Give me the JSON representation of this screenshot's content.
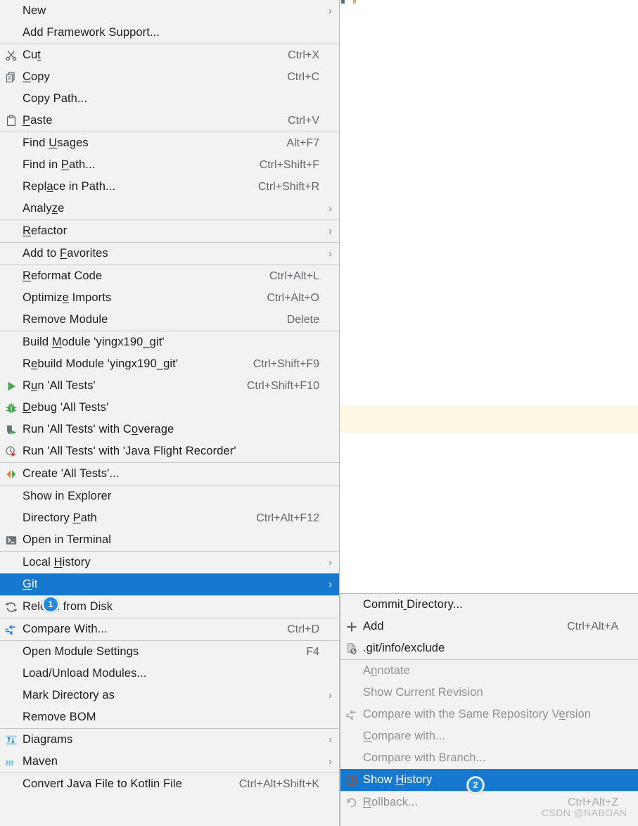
{
  "watermark": "CSDN @NABOAN",
  "context_menu": {
    "groups": [
      {
        "items": [
          {
            "label": "New",
            "accel": "",
            "icon": "",
            "arrow": true,
            "disabled": false,
            "selected": false,
            "mnemonic": -1
          },
          {
            "label": "Add Framework Support...",
            "accel": "",
            "icon": "",
            "arrow": false,
            "disabled": false,
            "selected": false,
            "mnemonic": -1
          }
        ]
      },
      {
        "items": [
          {
            "label": "Cut",
            "accel": "Ctrl+X",
            "icon": "scissors-icon",
            "arrow": false,
            "disabled": false,
            "selected": false,
            "mnemonic": 2
          },
          {
            "label": "Copy",
            "accel": "Ctrl+C",
            "icon": "copy-icon",
            "arrow": false,
            "disabled": false,
            "selected": false,
            "mnemonic": 0
          },
          {
            "label": "Copy Path...",
            "accel": "",
            "icon": "",
            "arrow": false,
            "disabled": false,
            "selected": false,
            "mnemonic": -1
          },
          {
            "label": "Paste",
            "accel": "Ctrl+V",
            "icon": "clipboard-icon",
            "arrow": false,
            "disabled": false,
            "selected": false,
            "mnemonic": 0
          }
        ]
      },
      {
        "items": [
          {
            "label": "Find Usages",
            "accel": "Alt+F7",
            "icon": "",
            "arrow": false,
            "disabled": false,
            "selected": false,
            "mnemonic": 5
          },
          {
            "label": "Find in Path...",
            "accel": "Ctrl+Shift+F",
            "icon": "",
            "arrow": false,
            "disabled": false,
            "selected": false,
            "mnemonic": 8
          },
          {
            "label": "Replace in Path...",
            "accel": "Ctrl+Shift+R",
            "icon": "",
            "arrow": false,
            "disabled": false,
            "selected": false,
            "mnemonic": 4
          },
          {
            "label": "Analyze",
            "accel": "",
            "icon": "",
            "arrow": true,
            "disabled": false,
            "selected": false,
            "mnemonic": 5
          }
        ]
      },
      {
        "items": [
          {
            "label": "Refactor",
            "accel": "",
            "icon": "",
            "arrow": true,
            "disabled": false,
            "selected": false,
            "mnemonic": 0
          }
        ]
      },
      {
        "items": [
          {
            "label": "Add to Favorites",
            "accel": "",
            "icon": "",
            "arrow": true,
            "disabled": false,
            "selected": false,
            "mnemonic": 7
          }
        ]
      },
      {
        "items": [
          {
            "label": "Reformat Code",
            "accel": "Ctrl+Alt+L",
            "icon": "",
            "arrow": false,
            "disabled": false,
            "selected": false,
            "mnemonic": 0
          },
          {
            "label": "Optimize Imports",
            "accel": "Ctrl+Alt+O",
            "icon": "",
            "arrow": false,
            "disabled": false,
            "selected": false,
            "mnemonic": 7
          },
          {
            "label": "Remove Module",
            "accel": "Delete",
            "icon": "",
            "arrow": false,
            "disabled": false,
            "selected": false,
            "mnemonic": -1
          }
        ]
      },
      {
        "items": [
          {
            "label": "Build Module 'yingx190_git'",
            "accel": "",
            "icon": "",
            "arrow": false,
            "disabled": false,
            "selected": false,
            "mnemonic": 6
          },
          {
            "label": "Rebuild Module 'yingx190_git'",
            "accel": "Ctrl+Shift+F9",
            "icon": "",
            "arrow": false,
            "disabled": false,
            "selected": false,
            "mnemonic": 1
          },
          {
            "label": "Run 'All Tests'",
            "accel": "Ctrl+Shift+F10",
            "icon": "run-icon",
            "arrow": false,
            "disabled": false,
            "selected": false,
            "mnemonic": 1
          },
          {
            "label": "Debug 'All Tests'",
            "accel": "",
            "icon": "debug-icon",
            "arrow": false,
            "disabled": false,
            "selected": false,
            "mnemonic": 0
          },
          {
            "label": "Run 'All Tests' with Coverage",
            "accel": "",
            "icon": "coverage-icon",
            "arrow": false,
            "disabled": false,
            "selected": false,
            "mnemonic": 22
          },
          {
            "label": "Run 'All Tests' with 'Java Flight Recorder'",
            "accel": "",
            "icon": "profiler-icon",
            "arrow": false,
            "disabled": false,
            "selected": false,
            "mnemonic": -1
          }
        ]
      },
      {
        "items": [
          {
            "label": "Create 'All Tests'...",
            "accel": "",
            "icon": "create-config-icon",
            "arrow": false,
            "disabled": false,
            "selected": false,
            "mnemonic": -1
          }
        ]
      },
      {
        "items": [
          {
            "label": "Show in Explorer",
            "accel": "",
            "icon": "",
            "arrow": false,
            "disabled": false,
            "selected": false,
            "mnemonic": -1
          },
          {
            "label": "Directory Path",
            "accel": "Ctrl+Alt+F12",
            "icon": "",
            "arrow": false,
            "disabled": false,
            "selected": false,
            "mnemonic": 10
          },
          {
            "label": "Open in Terminal",
            "accel": "",
            "icon": "terminal-icon",
            "arrow": false,
            "disabled": false,
            "selected": false,
            "mnemonic": -1
          }
        ]
      },
      {
        "items": [
          {
            "label": "Local History",
            "accel": "",
            "icon": "",
            "arrow": true,
            "disabled": false,
            "selected": false,
            "mnemonic": 6
          },
          {
            "label": "Git",
            "accel": "",
            "icon": "",
            "arrow": true,
            "disabled": false,
            "selected": true,
            "mnemonic": 0,
            "badge": "1"
          }
        ]
      },
      {
        "items": [
          {
            "label": "Reload from Disk",
            "accel": "",
            "icon": "reload-icon",
            "arrow": false,
            "disabled": false,
            "selected": false,
            "mnemonic": -1
          }
        ]
      },
      {
        "items": [
          {
            "label": "Compare With...",
            "accel": "Ctrl+D",
            "icon": "compare-icon",
            "arrow": false,
            "disabled": false,
            "selected": false,
            "mnemonic": -1
          }
        ]
      },
      {
        "items": [
          {
            "label": "Open Module Settings",
            "accel": "F4",
            "icon": "",
            "arrow": false,
            "disabled": false,
            "selected": false,
            "mnemonic": -1
          },
          {
            "label": "Load/Unload Modules...",
            "accel": "",
            "icon": "",
            "arrow": false,
            "disabled": false,
            "selected": false,
            "mnemonic": -1
          },
          {
            "label": "Mark Directory as",
            "accel": "",
            "icon": "",
            "arrow": true,
            "disabled": false,
            "selected": false,
            "mnemonic": -1
          },
          {
            "label": "Remove BOM",
            "accel": "",
            "icon": "",
            "arrow": false,
            "disabled": false,
            "selected": false,
            "mnemonic": -1
          }
        ]
      },
      {
        "items": [
          {
            "label": "Diagrams",
            "accel": "",
            "icon": "diagrams-icon",
            "arrow": true,
            "disabled": false,
            "selected": false,
            "mnemonic": -1
          },
          {
            "label": "Maven",
            "accel": "",
            "icon": "maven-icon",
            "arrow": true,
            "disabled": false,
            "selected": false,
            "mnemonic": -1
          }
        ]
      },
      {
        "items": [
          {
            "label": "Convert Java File to Kotlin File",
            "accel": "Ctrl+Alt+Shift+K",
            "icon": "",
            "arrow": false,
            "disabled": false,
            "selected": false,
            "mnemonic": -1
          }
        ]
      }
    ]
  },
  "git_submenu": {
    "groups": [
      {
        "items": [
          {
            "label": "Commit Directory...",
            "accel": "",
            "icon": "",
            "arrow": false,
            "disabled": false,
            "selected": false,
            "mnemonic": 6
          },
          {
            "label": "Add",
            "accel": "Ctrl+Alt+A",
            "icon": "plus-icon",
            "arrow": false,
            "disabled": false,
            "selected": false,
            "mnemonic": -1
          },
          {
            "label": ".git/info/exclude",
            "accel": "",
            "icon": "file-ignored-icon",
            "arrow": false,
            "disabled": false,
            "selected": false,
            "mnemonic": -1
          }
        ]
      },
      {
        "items": [
          {
            "label": "Annotate",
            "accel": "",
            "icon": "",
            "arrow": false,
            "disabled": true,
            "selected": false,
            "mnemonic": 1
          },
          {
            "label": "Show Current Revision",
            "accel": "",
            "icon": "",
            "arrow": false,
            "disabled": true,
            "selected": false,
            "mnemonic": -1
          },
          {
            "label": "Compare with the Same Repository Version",
            "accel": "",
            "icon": "compare-icon-gray",
            "arrow": false,
            "disabled": true,
            "selected": false,
            "mnemonic": 34
          },
          {
            "label": "Compare with...",
            "accel": "",
            "icon": "",
            "arrow": false,
            "disabled": true,
            "selected": false,
            "mnemonic": 0
          },
          {
            "label": "Compare with Branch...",
            "accel": "",
            "icon": "",
            "arrow": false,
            "disabled": true,
            "selected": false,
            "mnemonic": -1
          },
          {
            "label": "Show History",
            "accel": "",
            "icon": "history-icon",
            "arrow": false,
            "disabled": false,
            "selected": true,
            "mnemonic": 5,
            "badge": "2"
          }
        ]
      },
      {
        "items": [
          {
            "label": "Rollback...",
            "accel": "Ctrl+Alt+Z",
            "icon": "rollback-icon",
            "arrow": false,
            "disabled": true,
            "selected": false,
            "mnemonic": 0
          }
        ]
      }
    ]
  },
  "colors": {
    "menu_bg": "#f2f2f2",
    "selection": "#1778cf",
    "separator": "#c9c9c9",
    "accel_text": "#62676d",
    "disabled_text": "#8d9196",
    "highlight_line": "#fdf8e3",
    "badge": "#1f8ae0"
  }
}
